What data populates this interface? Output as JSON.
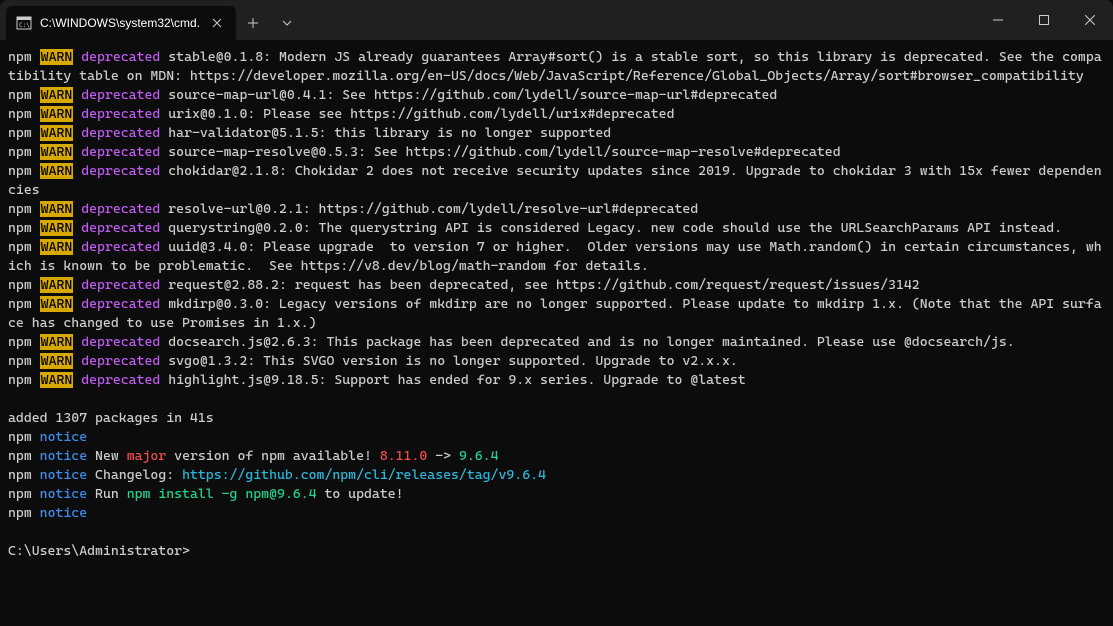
{
  "titlebar": {
    "tab_title": "C:\\WINDOWS\\system32\\cmd."
  },
  "lines": [
    {
      "type": "warn",
      "message": "stable@0.1.8: Modern JS already guarantees Array#sort() is a stable sort, so this library is deprecated. See the compatibility table on MDN: https://developer.mozilla.org/en-US/docs/Web/JavaScript/Reference/Global_Objects/Array/sort#browser_compatibility"
    },
    {
      "type": "warn",
      "message": "source-map-url@0.4.1: See https://github.com/lydell/source-map-url#deprecated"
    },
    {
      "type": "warn",
      "message": "urix@0.1.0: Please see https://github.com/lydell/urix#deprecated"
    },
    {
      "type": "warn",
      "message": "har-validator@5.1.5: this library is no longer supported"
    },
    {
      "type": "warn",
      "message": "source-map-resolve@0.5.3: See https://github.com/lydell/source-map-resolve#deprecated"
    },
    {
      "type": "warn",
      "message": "chokidar@2.1.8: Chokidar 2 does not receive security updates since 2019. Upgrade to chokidar 3 with 15x fewer dependencies"
    },
    {
      "type": "warn",
      "message": "resolve-url@0.2.1: https://github.com/lydell/resolve-url#deprecated"
    },
    {
      "type": "warn",
      "message": "querystring@0.2.0: The querystring API is considered Legacy. new code should use the URLSearchParams API instead."
    },
    {
      "type": "warn",
      "message": "uuid@3.4.0: Please upgrade  to version 7 or higher.  Older versions may use Math.random() in certain circumstances, which is known to be problematic.  See https://v8.dev/blog/math-random for details."
    },
    {
      "type": "warn",
      "message": "request@2.88.2: request has been deprecated, see https://github.com/request/request/issues/3142"
    },
    {
      "type": "warn",
      "message": "mkdirp@0.3.0: Legacy versions of mkdirp are no longer supported. Please update to mkdirp 1.x. (Note that the API surface has changed to use Promises in 1.x.)"
    },
    {
      "type": "warn",
      "message": "docsearch.js@2.6.3: This package has been deprecated and is no longer maintained. Please use @docsearch/js."
    },
    {
      "type": "warn",
      "message": "svgo@1.3.2: This SVGO version is no longer supported. Upgrade to v2.x.x."
    },
    {
      "type": "warn",
      "message": "highlight.js@9.18.5: Support has ended for 9.x series. Upgrade to @latest"
    }
  ],
  "added": "added 1307 packages in 41s",
  "notice": {
    "new_text_pre": "New ",
    "major": "major",
    "new_text_post": " version of npm available! ",
    "old_version": "8.11.0",
    "arrow": " -> ",
    "new_version": "9.6.4",
    "changelog_label": "Changelog: ",
    "changelog_url": "https://github.com/npm/cli/releases/tag/v9.6.4",
    "run_pre": "Run ",
    "run_cmd": "npm install -g npm@9.6.4",
    "run_post": " to update!"
  },
  "prompt": "C:\\Users\\Administrator>",
  "labels": {
    "npm": "npm",
    "warn": "WARN",
    "deprecated": "deprecated",
    "notice": "notice"
  }
}
